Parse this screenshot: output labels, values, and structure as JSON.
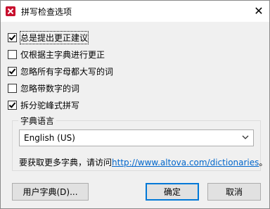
{
  "window": {
    "title": "拼写检查选项",
    "close_glyph": "✕"
  },
  "options": [
    {
      "label": "总是提出更正建议",
      "checked": true
    },
    {
      "label": "仅根据主字典进行更正",
      "checked": false
    },
    {
      "label": "忽略所有字母都大写的词",
      "checked": true
    },
    {
      "label": "忽略带数字的词",
      "checked": false
    },
    {
      "label": "拆分驼峰式拼写",
      "checked": true
    }
  ],
  "dictionary_language": {
    "group_title": "字典语言",
    "selected": "English (US)",
    "info_prefix": "要获取更多字典，请访问",
    "link_text": "http://www.altova.com/dictionaries",
    "info_suffix": "。"
  },
  "buttons": {
    "user_dictionary": "用户字典(D)...",
    "ok": "确定",
    "cancel": "取消"
  },
  "colors": {
    "app_icon": "#c8102e",
    "link": "#0066cc",
    "default_button_border": "#0078d7"
  },
  "icons": {
    "app": "altova-app-icon",
    "close": "close-icon",
    "dropdown": "chevron-down-icon"
  }
}
